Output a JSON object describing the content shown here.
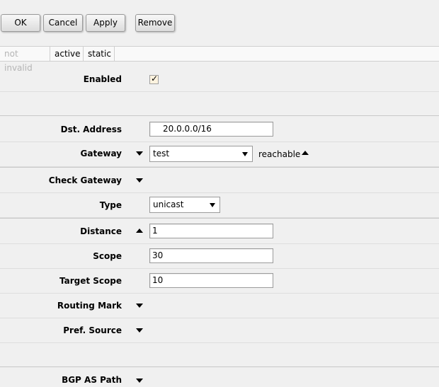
{
  "toolbar": {
    "ok": "OK",
    "cancel": "Cancel",
    "apply": "Apply",
    "remove": "Remove"
  },
  "flags": [
    "not invalid",
    "active",
    "static"
  ],
  "form": {
    "enabled": {
      "label": "Enabled",
      "checked": true,
      "checkmark": "✓"
    },
    "dst_address": {
      "label": "Dst. Address",
      "value": "20.0.0.0/16"
    },
    "gateway": {
      "label": "Gateway",
      "value": "test",
      "status": "reachable"
    },
    "check_gateway": {
      "label": "Check Gateway"
    },
    "type": {
      "label": "Type",
      "value": "unicast"
    },
    "distance": {
      "label": "Distance",
      "value": "1"
    },
    "scope": {
      "label": "Scope",
      "value": "30"
    },
    "target_scope": {
      "label": "Target Scope",
      "value": "10"
    },
    "routing_mark": {
      "label": "Routing Mark"
    },
    "pref_source": {
      "label": "Pref. Source"
    },
    "bgp_as_path": {
      "label": "BGP AS Path"
    }
  }
}
